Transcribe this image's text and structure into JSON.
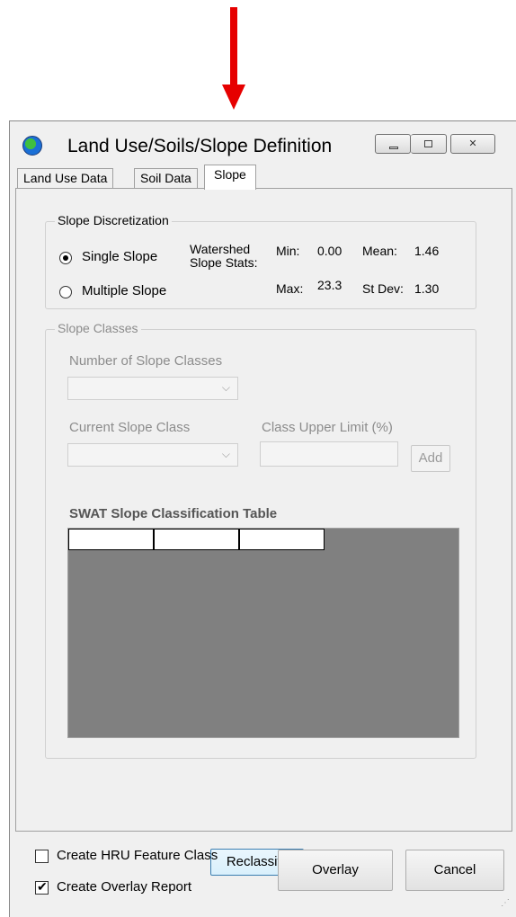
{
  "window": {
    "title": "Land Use/Soils/Slope Definition",
    "controls": {
      "minimize": "minimize",
      "maximize": "maximize",
      "close": "close"
    }
  },
  "tabs": [
    {
      "label": "Land Use Data",
      "active": false
    },
    {
      "label": "Soil Data",
      "active": false
    },
    {
      "label": "Slope",
      "active": true
    }
  ],
  "slope_discretization": {
    "legend": "Slope Discretization",
    "options": [
      {
        "label": "Single Slope",
        "selected": true
      },
      {
        "label": "Multiple Slope",
        "selected": false
      }
    ],
    "stats_label_line1": "Watershed",
    "stats_label_line2": "Slope Stats:",
    "min_label": "Min:",
    "min_value": "0.00",
    "max_label": "Max:",
    "max_value": "23.3",
    "mean_label": "Mean:",
    "mean_value": "1.46",
    "stdev_label": "St Dev:",
    "stdev_value": "1.30"
  },
  "slope_classes": {
    "legend": "Slope Classes",
    "number_label": "Number of Slope Classes",
    "current_label": "Current Slope Class",
    "upper_limit_label": "Class Upper Limit (%)",
    "add_button": "Add",
    "table_title": "SWAT Slope Classification Table",
    "table_columns": [
      "",
      "",
      ""
    ]
  },
  "reclassify_button": "Reclassify",
  "options": {
    "create_hru": {
      "label": "Create HRU Feature Class",
      "checked": false
    },
    "create_report": {
      "label": "Create Overlay Report",
      "checked": true
    }
  },
  "overlay_button": "Overlay",
  "cancel_button": "Cancel",
  "colors": {
    "arrow": "#e60000",
    "window_bg": "#f0f0f0",
    "table_bg": "#808080"
  }
}
